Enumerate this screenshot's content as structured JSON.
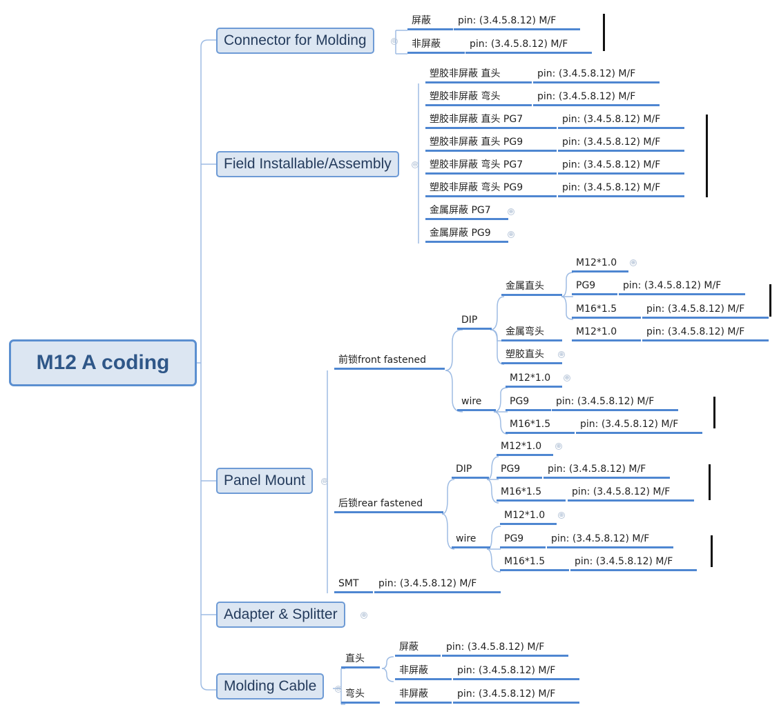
{
  "root": {
    "label": "M12 A coding"
  },
  "branches": {
    "connector_molding": {
      "label": "Connector for Molding",
      "children": [
        {
          "label": "屏蔽",
          "detail": "pin:  (3.4.5.8.12)  M/F"
        },
        {
          "label": "非屏蔽",
          "detail": "pin:  (3.4.5.8.12)  M/F"
        }
      ]
    },
    "field_installable": {
      "label": "Field Installable/Assembly",
      "children": [
        {
          "label": "塑胶非屏蔽 直头",
          "detail": "pin:  (3.4.5.8.12)  M/F"
        },
        {
          "label": "塑胶非屏蔽 弯头",
          "detail": "pin:  (3.4.5.8.12)  M/F"
        },
        {
          "label": "塑胶非屏蔽 直头 PG7",
          "detail": "pin:  (3.4.5.8.12)  M/F"
        },
        {
          "label": "塑胶非屏蔽 直头 PG9",
          "detail": "pin:  (3.4.5.8.12)  M/F"
        },
        {
          "label": "塑胶非屏蔽 弯头 PG7",
          "detail": "pin:  (3.4.5.8.12)  M/F"
        },
        {
          "label": "塑胶非屏蔽 弯头 PG9",
          "detail": "pin:  (3.4.5.8.12)  M/F"
        },
        {
          "label": "金属屏蔽 PG7",
          "collapsed": true
        },
        {
          "label": "金属屏蔽 PG9",
          "collapsed": true
        }
      ]
    },
    "panel_mount": {
      "label": "Panel Mount",
      "front": {
        "label": "前锁front fastened",
        "dip": {
          "label": "DIP",
          "metal_straight": {
            "label": "金属直头",
            "children": [
              {
                "label": "M12*1.0",
                "collapsed": true
              },
              {
                "label": "PG9",
                "detail": "pin:  (3.4.5.8.12)  M/F"
              },
              {
                "label": "M16*1.5",
                "detail": "pin:  (3.4.5.8.12)  M/F"
              }
            ]
          },
          "metal_angled": {
            "label": "金属弯头",
            "children": [
              {
                "label": "M12*1.0",
                "detail": "pin:  (3.4.5.8.12)  M/F"
              }
            ]
          },
          "plastic_straight": {
            "label": "塑胶直头",
            "collapsed": true
          }
        },
        "wire": {
          "label": "wire",
          "children": [
            {
              "label": "M12*1.0",
              "collapsed": true
            },
            {
              "label": "PG9",
              "detail": "pin:  (3.4.5.8.12)  M/F"
            },
            {
              "label": "M16*1.5",
              "detail": "pin:  (3.4.5.8.12)  M/F"
            }
          ]
        }
      },
      "rear": {
        "label": "后锁rear fastened",
        "dip": {
          "label": "DIP",
          "children": [
            {
              "label": "M12*1.0",
              "collapsed": true
            },
            {
              "label": "PG9",
              "detail": "pin:  (3.4.5.8.12)  M/F"
            },
            {
              "label": "M16*1.5",
              "detail": "pin:  (3.4.5.8.12)  M/F"
            }
          ]
        },
        "wire": {
          "label": "wire",
          "children": [
            {
              "label": "M12*1.0",
              "collapsed": true
            },
            {
              "label": "PG9",
              "detail": "pin:  (3.4.5.8.12)  M/F"
            },
            {
              "label": "M16*1.5",
              "detail": "pin:  (3.4.5.8.12)  M/F"
            }
          ]
        }
      },
      "smt": {
        "label": "SMT",
        "detail": "pin:  (3.4.5.8.12)  M/F"
      }
    },
    "adapter_splitter": {
      "label": "Adapter & Splitter",
      "collapsed": true
    },
    "molding_cable": {
      "label": "Molding Cable",
      "straight": {
        "label": "直头",
        "children": [
          {
            "label": "屏蔽",
            "detail": "pin:  (3.4.5.8.12)  M/F"
          },
          {
            "label": "非屏蔽",
            "detail": "pin:  (3.4.5.8.12)  M/F"
          }
        ]
      },
      "angled": {
        "label": "弯头",
        "children": [
          {
            "label": "非屏蔽",
            "detail": "pin:  (3.4.5.8.12)  M/F"
          }
        ]
      }
    }
  },
  "toggle_icons": {
    "expanded": "⊖",
    "collapsed": "⊕"
  },
  "colors": {
    "node_fill": "#dce6f2",
    "node_border": "#5b8fd0",
    "underline": "#4e86d1",
    "connector": "#9dbbe3",
    "text_dark": "#2f5788"
  }
}
